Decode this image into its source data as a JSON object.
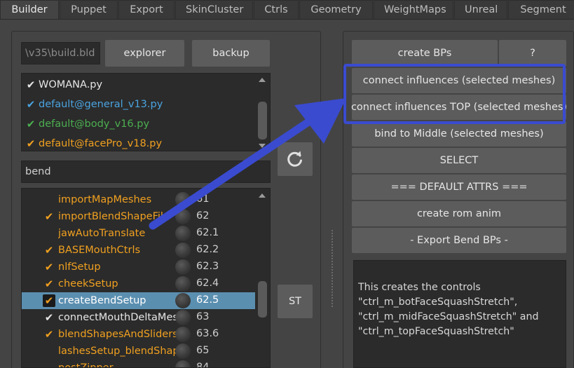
{
  "tabs": [
    {
      "label": "Builder",
      "active": true
    },
    {
      "label": "Puppet"
    },
    {
      "label": "Export"
    },
    {
      "label": "SkinCluster"
    },
    {
      "label": "Ctrls"
    },
    {
      "label": "Geometry"
    },
    {
      "label": "WeightMaps"
    },
    {
      "label": "Unreal"
    },
    {
      "label": "Segment"
    }
  ],
  "left": {
    "path_field": "\\v35\\build.bld",
    "explorer_label": "explorer",
    "backup_label": "backup",
    "files": [
      {
        "label": "WOMANA.py",
        "color": "#e6e6e6"
      },
      {
        "label": "default@general_v13.py",
        "color": "#4aa3df"
      },
      {
        "label": "default@body_v16.py",
        "color": "#4caf50"
      },
      {
        "label": "default@facePro_v18.py",
        "color": "#f0a020"
      }
    ],
    "filter_field": "bend",
    "refresh_icon": "refresh-icon",
    "st_label": "ST",
    "steps": [
      {
        "label": "importMapMeshes",
        "num": "61",
        "checked": false,
        "color": "#f0a020"
      },
      {
        "label": "importBlendShapeFile",
        "num": "62",
        "checked": true,
        "color": "#f0a020"
      },
      {
        "label": "jawAutoTranslate",
        "num": "62.1",
        "checked": false,
        "color": "#f0a020"
      },
      {
        "label": "BASEMouthCtrls",
        "num": "62.2",
        "checked": true,
        "color": "#f0a020"
      },
      {
        "label": "nlfSetup",
        "num": "62.3",
        "checked": true,
        "color": "#f0a020"
      },
      {
        "label": "cheekSetup",
        "num": "62.4",
        "checked": true,
        "color": "#f0a020"
      },
      {
        "label": "createBendSetup",
        "num": "62.5",
        "checked": true,
        "color": "#ffffff",
        "selected": true
      },
      {
        "label": "connectMouthDeltaMesh",
        "num": "63",
        "checked": true,
        "color": "#e6e6e6"
      },
      {
        "label": "blendShapesAndSliders",
        "num": "63.6",
        "checked": true,
        "color": "#f0a020"
      },
      {
        "label": "lashesSetup_blendShapes",
        "num": "65",
        "checked": false,
        "color": "#f0a020"
      },
      {
        "label": "postZipper",
        "num": "84",
        "checked": false,
        "color": "#f0a020"
      }
    ]
  },
  "right": {
    "create_bps_label": "create BPs",
    "help_label": "?",
    "buttons": [
      "connect influences (selected meshes)",
      "connect influences TOP (selected meshes)",
      "bind to Middle (selected meshes)",
      "SELECT",
      "=== DEFAULT ATTRS ===",
      "create rom anim",
      "- Export Bend BPs -"
    ],
    "description": "This creates the controls \"ctrl_m_botFaceSquashStretch\", \"ctrl_m_midFaceSquashStretch\" and \"ctrl_m_topFaceSquashStretch\""
  },
  "colors": {
    "annotation": "#3a4bd0",
    "selection": "#5b8fb0"
  }
}
